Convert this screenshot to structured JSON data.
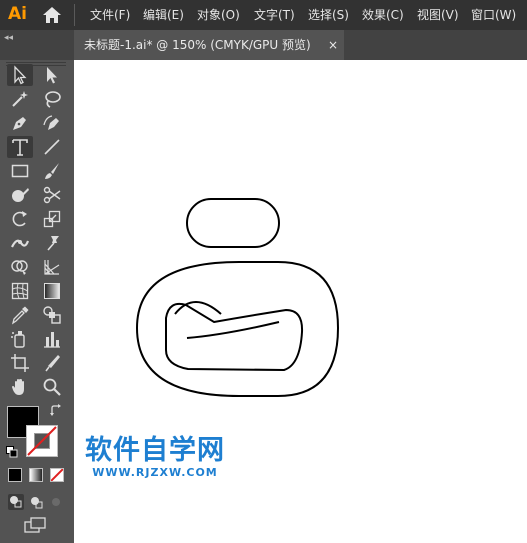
{
  "app": {
    "logo_text": "Ai"
  },
  "menu": {
    "items": [
      "文件(F)",
      "编辑(E)",
      "对象(O)",
      "文字(T)",
      "选择(S)",
      "效果(C)",
      "视图(V)",
      "窗口(W)"
    ]
  },
  "tab": {
    "title": "未标题-1.ai* @ 150% (CMYK/GPU 预览)",
    "close_glyph": "×"
  },
  "panel": {
    "collapse_glyph": "◂◂"
  },
  "watermark": {
    "text": "软件自学网",
    "url": "WWW.RJZXW.COM"
  },
  "colors": {
    "fill": "#000000",
    "stroke": "#ffffff",
    "accent_logo": "#ff9a00",
    "watermark": "#1e7fd1"
  },
  "tools": [
    "selection-tool",
    "direct-selection-tool",
    "magic-wand-tool",
    "lasso-tool",
    "pen-tool",
    "curvature-tool",
    "type-tool",
    "line-segment-tool",
    "rectangle-tool",
    "paintbrush-tool",
    "shaper-tool",
    "scissors-tool",
    "rotate-tool",
    "scale-tool",
    "width-tool",
    "puppet-warp-tool",
    "shape-builder-tool",
    "perspective-grid-tool",
    "mesh-tool",
    "gradient-tool",
    "eyedropper-tool",
    "blend-tool",
    "symbol-sprayer-tool",
    "column-graph-tool",
    "artboard-tool",
    "slice-tool",
    "hand-tool",
    "zoom-tool"
  ]
}
